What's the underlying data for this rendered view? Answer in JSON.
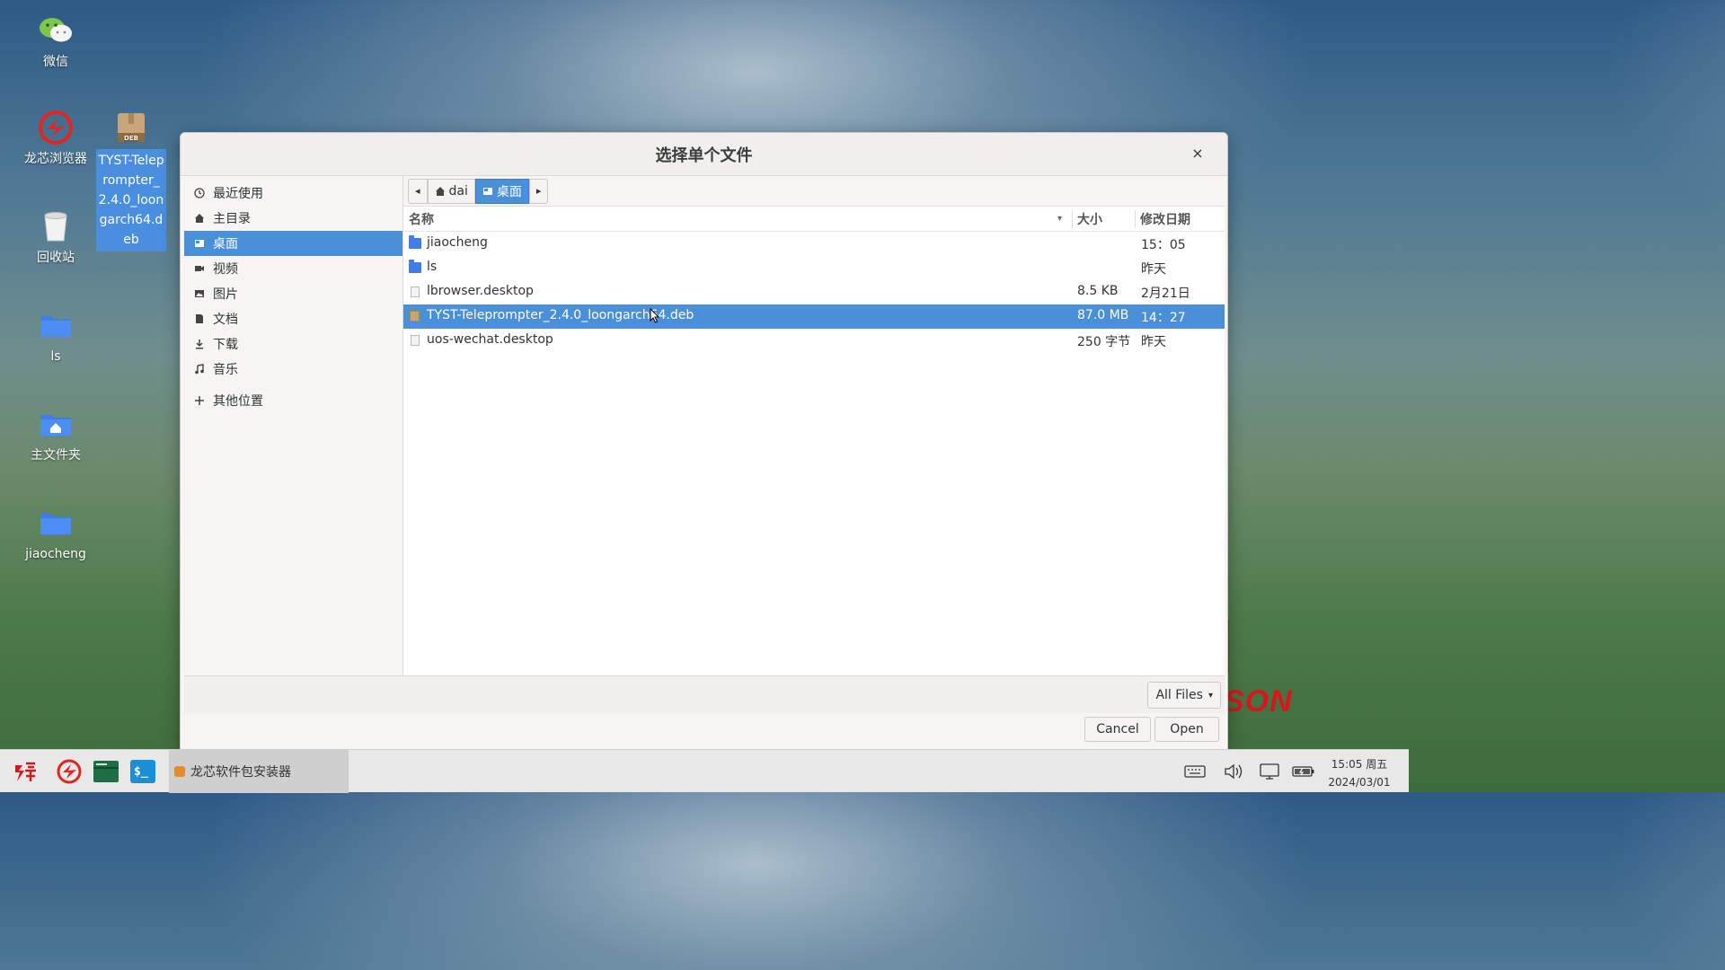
{
  "desktop": {
    "icons": [
      {
        "label": "微信"
      },
      {
        "label": "龙芯浏览器"
      },
      {
        "label": "回收站"
      },
      {
        "label": "ls"
      },
      {
        "label": "主文件夹"
      },
      {
        "label": "jiaocheng"
      },
      {
        "label": "TYST-Teleprompter_2.4.0_loongarch64.deb",
        "badge": "DEB"
      }
    ],
    "brand_text": "SON"
  },
  "dialog": {
    "title": "选择单个文件",
    "close_glyph": "×",
    "sidebar": [
      {
        "label": "最近使用",
        "icon": "clock-icon"
      },
      {
        "label": "主目录",
        "icon": "home-icon"
      },
      {
        "label": "桌面",
        "icon": "desktop-icon"
      },
      {
        "label": "视频",
        "icon": "video-icon"
      },
      {
        "label": "图片",
        "icon": "image-icon"
      },
      {
        "label": "文档",
        "icon": "document-icon"
      },
      {
        "label": "下载",
        "icon": "download-icon"
      },
      {
        "label": "音乐",
        "icon": "music-icon"
      },
      {
        "label": "其他位置",
        "icon": "plus-icon"
      }
    ],
    "pathbar": {
      "back": "◂",
      "home": "dai",
      "current": "桌面",
      "forward": "▸"
    },
    "columns": {
      "name": "名称",
      "size": "大小",
      "modified": "修改日期",
      "sort_glyph": "▾"
    },
    "files": [
      {
        "name": "jiaocheng",
        "size": "",
        "modified": "15：05",
        "type": "folder"
      },
      {
        "name": "ls",
        "size": "",
        "modified": "昨天",
        "type": "folder"
      },
      {
        "name": "lbrowser.desktop",
        "size": "8.5 KB",
        "modified": "2月21日",
        "type": "file"
      },
      {
        "name": "TYST-Teleprompter_2.4.0_loongarch64.deb",
        "size": "87.0 MB",
        "modified": "14：27",
        "type": "deb"
      },
      {
        "name": "uos-wechat.desktop",
        "size": "250 字节",
        "modified": "昨天",
        "type": "file"
      }
    ],
    "filter": {
      "label": "All Files",
      "caret": "▾"
    },
    "buttons": {
      "cancel": "Cancel",
      "open": "Open"
    }
  },
  "taskbar": {
    "task_label": "龙芯软件包安装器",
    "clock_time": "15:05 周五",
    "clock_date": "2024/03/01"
  },
  "colors": {
    "accent": "#4a90d9",
    "brand_red": "#d8161b"
  }
}
